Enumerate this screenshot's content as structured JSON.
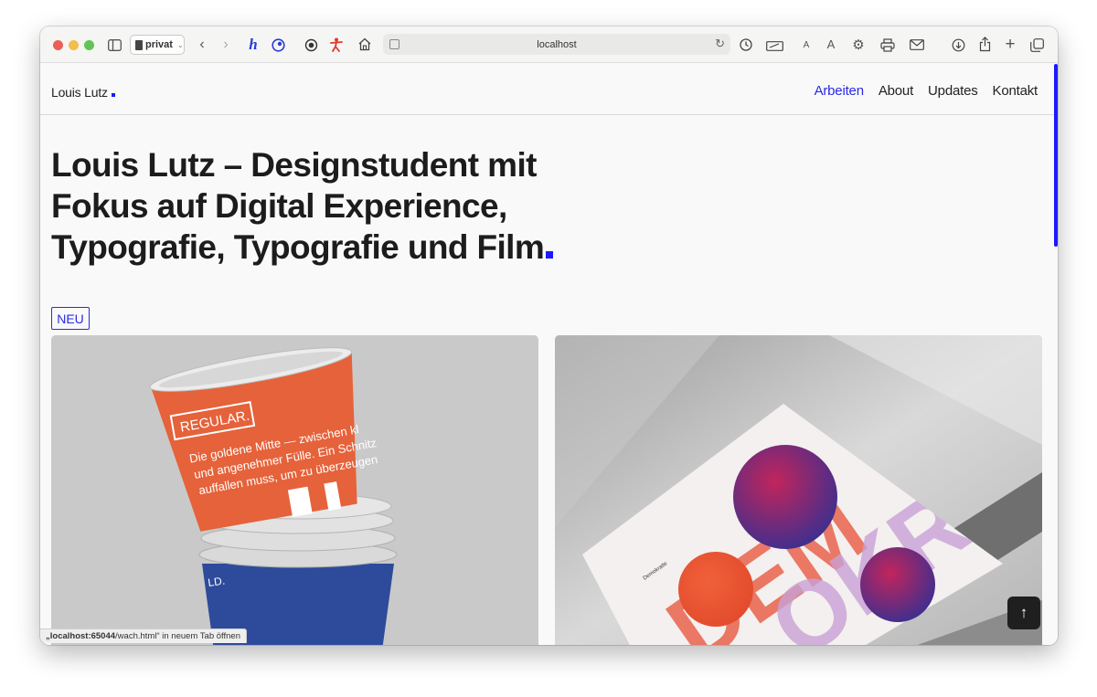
{
  "browser": {
    "profile_label": "privat",
    "address": "localhost",
    "status_host": "„localhost:65044",
    "status_path": "/wach.html“ in neuem Tab öffnen",
    "toolbar_icons": [
      "sidebar-icon",
      "back-icon",
      "forward-icon",
      "hypothesis-extension-icon",
      "color-extension-icon",
      "target-extension-icon",
      "figure-extension-icon",
      "home-icon",
      "reader-icon",
      "reload-icon",
      "history-icon",
      "sign-icon",
      "smaller-text-icon",
      "larger-text-icon",
      "settings-icon",
      "print-icon",
      "mail-icon",
      "download-icon",
      "share-icon",
      "new-tab-icon",
      "tabs-overview-icon"
    ]
  },
  "site": {
    "logo": "Louis Lutz",
    "nav": [
      "Arbeiten",
      "About",
      "Updates",
      "Kontakt"
    ],
    "headline": "Louis Lutz  –  Designstudent mit Fokus auf Digital Experience, Typografie, Typografie und Film",
    "badge": "NEU",
    "cup_label": "REGULAR.",
    "cup_text_1": "Die goldene Mitte — zwischen kl",
    "cup_text_2": "und angenehmer Fülle. Ein Schnitz",
    "cup_text_3": "auffallen muss, um zu überzeugen",
    "poster_word": "DEMOKRATIE",
    "back_to_top": "↑"
  },
  "colors": {
    "accent": "#1a1aff",
    "nav_active": "#2a2ae6",
    "cup_orange": "#e5623a",
    "cup_blue": "#2d4b9a"
  }
}
